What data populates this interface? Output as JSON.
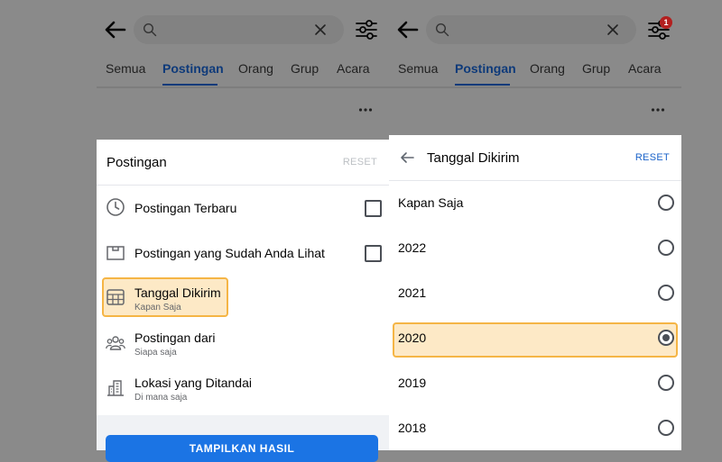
{
  "panels": [
    {
      "tabs": [
        "Semua",
        "Postingan",
        "Orang",
        "Grup",
        "Acara"
      ],
      "active_tab": "Postingan",
      "sheet": {
        "title": "Postingan",
        "reset_label": "RESET",
        "items": [
          {
            "title": "Postingan Terbaru",
            "icon": "clock-icon",
            "control": "checkbox",
            "checked": false
          },
          {
            "title": "Postingan yang Sudah Anda Lihat",
            "icon": "folder-icon",
            "control": "checkbox",
            "checked": false
          },
          {
            "title": "Tanggal Dikirim",
            "subtitle": "Kapan Saja",
            "icon": "calendar-icon",
            "highlighted": true
          },
          {
            "title": "Postingan dari",
            "subtitle": "Siapa saja",
            "icon": "people-icon"
          },
          {
            "title": "Lokasi yang Ditandai",
            "subtitle": "Di mana saja",
            "icon": "building-icon"
          }
        ],
        "apply_label": "TAMPILKAN HASIL"
      }
    },
    {
      "tabs": [
        "Semua",
        "Postingan",
        "Orang",
        "Grup",
        "Acara"
      ],
      "active_tab": "Postingan",
      "filter_badge": "1",
      "sheet": {
        "title": "Tanggal Dikirim",
        "reset_label": "RESET",
        "options": [
          {
            "label": "Kapan Saja",
            "selected": false
          },
          {
            "label": "2022",
            "selected": false
          },
          {
            "label": "2021",
            "selected": false
          },
          {
            "label": "2020",
            "selected": true
          },
          {
            "label": "2019",
            "selected": false
          },
          {
            "label": "2018",
            "selected": false
          }
        ]
      }
    }
  ],
  "colors": {
    "accent": "#1b74e4",
    "active_tab": "#0e3a7a",
    "highlight_border": "#f5b545",
    "highlight_fill": "#fde9c6",
    "badge": "#b3201f"
  }
}
